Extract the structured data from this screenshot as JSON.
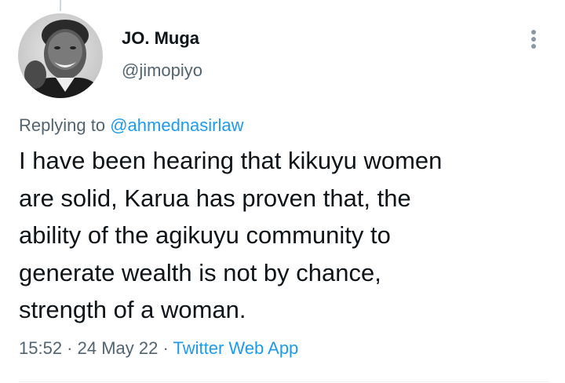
{
  "tweet": {
    "author": {
      "display_name": "JO. Muga",
      "handle": "@jimopiyo",
      "avatar_icon": "profile-photo"
    },
    "more_icon": "three-dots-vertical-icon",
    "reply": {
      "prefix": "Replying to",
      "mention": "@ahmednasirlaw"
    },
    "text": "I have been hearing that kikuyu women\nare solid, Karua has proven that, the\nability of the agikuyu community to\ngenerate wealth is not by chance,\nstrength of a woman.",
    "meta": {
      "time": "15:52",
      "separator": " · ",
      "date": "24 May 22",
      "source": "Twitter Web App"
    },
    "colors": {
      "link": "#1d9bf0",
      "secondary_text": "#536471",
      "primary_text": "#0f1419"
    }
  }
}
